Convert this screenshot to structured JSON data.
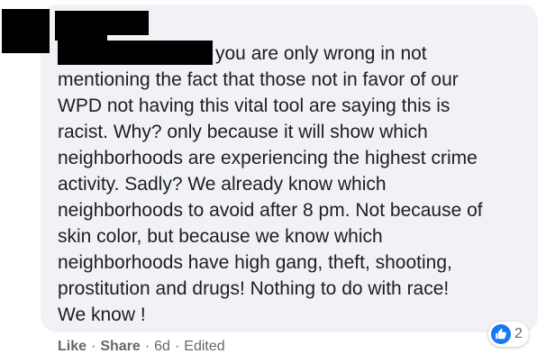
{
  "comment": {
    "body_lines": [
      "you are only wrong in not",
      "mentioning the fact that those not in favor of our",
      "WPD not having this vital tool are saying this is",
      "racist. Why? only because it will show which",
      "neighborhoods are experiencing the highest crime",
      "activity. Sadly? We already know which",
      "neighborhoods to avoid after 8 pm. Not because of",
      "skin color, but because we know which",
      "neighborhoods have high gang, theft, shooting,",
      "prostitution and drugs! Nothing to do with race!",
      "We know !"
    ]
  },
  "actions": {
    "like_label": "Like",
    "share_label": "Share",
    "separator": "·",
    "age": "6d",
    "edited_label": "Edited"
  },
  "reactions": {
    "icon": "thumbs-up-icon",
    "count": "2",
    "color": "#1877f2"
  },
  "colors": {
    "bubble_bg": "#f0f2f5",
    "text": "#1c1e21",
    "secondary_text": "#65676b"
  }
}
